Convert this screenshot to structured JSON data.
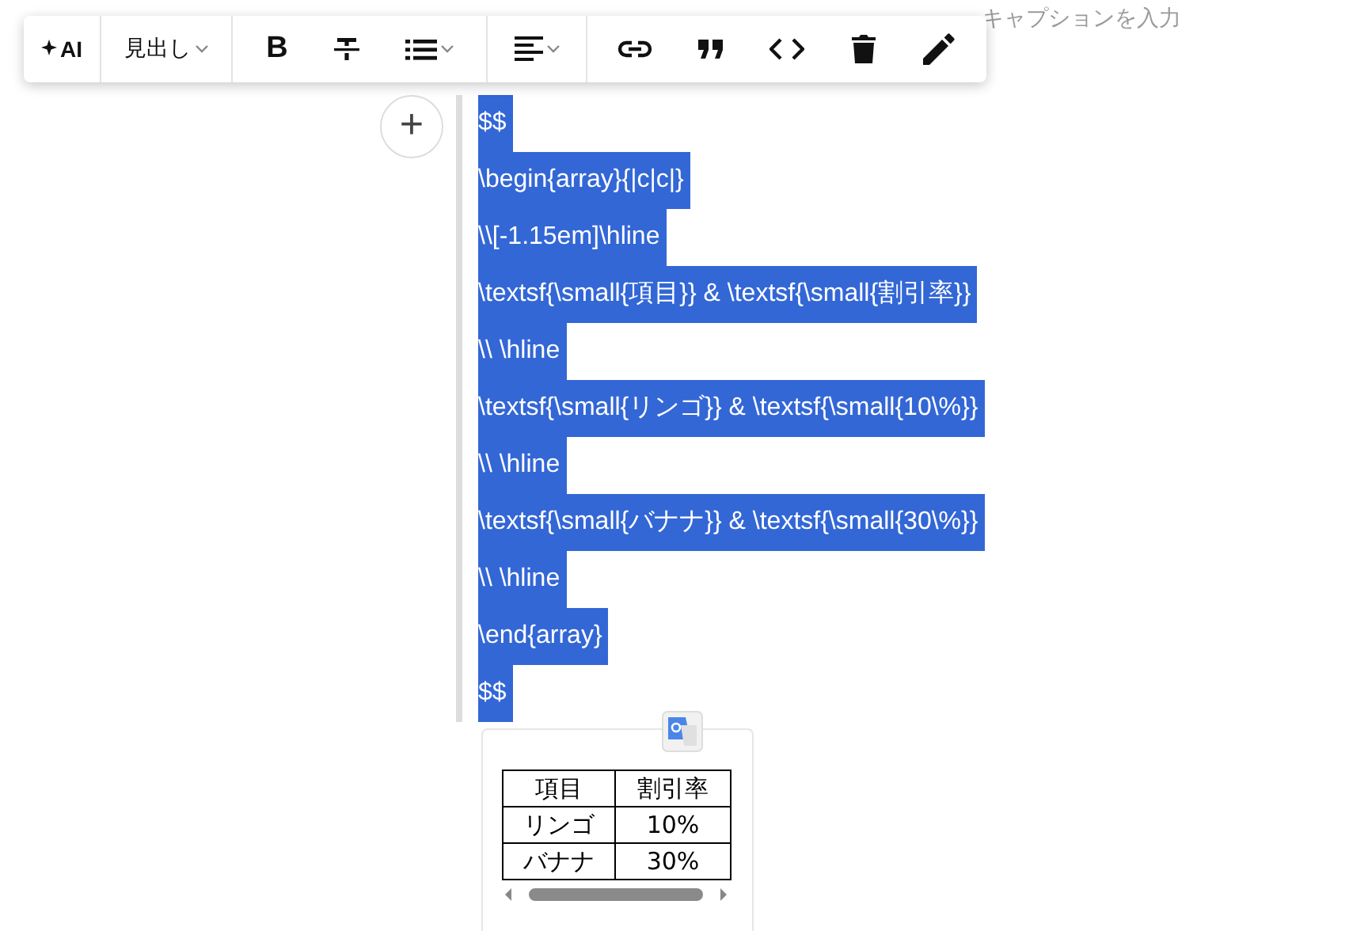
{
  "caption": {
    "placeholder": "キャプションを入力"
  },
  "toolbar": {
    "groups": [
      [
        {
          "kind": "ai",
          "label": "AI"
        }
      ],
      [
        {
          "kind": "heading",
          "label": "見出し",
          "dropdown": true
        }
      ],
      [
        {
          "kind": "bold",
          "label": "B"
        },
        {
          "kind": "strike"
        },
        {
          "kind": "list",
          "dropdown": true
        }
      ],
      [
        {
          "kind": "align",
          "dropdown": true
        }
      ],
      [
        {
          "kind": "link"
        },
        {
          "kind": "quote"
        },
        {
          "kind": "code"
        },
        {
          "kind": "delete"
        },
        {
          "kind": "edit"
        }
      ]
    ]
  },
  "editor": {
    "add_button": "+",
    "lines": [
      {
        "text": "$$",
        "selected": true
      },
      {
        "text": "\\begin{array}{|c|c|}",
        "selected": true
      },
      {
        "text": "\\\\[-1.15em]\\hline",
        "selected": true
      },
      {
        "text": "\\textsf{\\small{項目}} & \\textsf{\\small{割引率}}",
        "selected": true
      },
      {
        "text": "\\\\ \\hline",
        "selected": true
      },
      {
        "text": "\\textsf{\\small{リンゴ}} & \\textsf{\\small{10\\%}}",
        "selected": true
      },
      {
        "text": "\\\\ \\hline",
        "selected": true
      },
      {
        "text": "\\textsf{\\small{バナナ}} & \\textsf{\\small{30\\%}}",
        "selected": true
      },
      {
        "text": "\\\\ \\hline",
        "selected": true
      },
      {
        "text": "\\end{array}",
        "selected": true
      },
      {
        "text": "$$",
        "selected": true
      }
    ]
  },
  "preview": {
    "table": {
      "columns": [
        "項目",
        "割引率"
      ],
      "rows": [
        [
          "リンゴ",
          "10%"
        ],
        [
          "バナナ",
          "30%"
        ]
      ]
    }
  }
}
